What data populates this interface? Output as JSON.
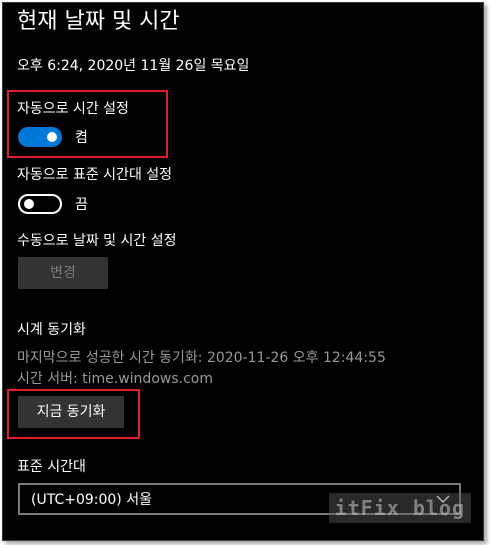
{
  "page": {
    "title": "현재 날짜 및 시간",
    "current_datetime": "오후 6:24, 2020년 11월 26일 목요일"
  },
  "auto_time": {
    "label": "자동으로 시간 설정",
    "state": "on",
    "state_text": "켬"
  },
  "auto_timezone": {
    "label": "자동으로 표준 시간대 설정",
    "state": "off",
    "state_text": "끔"
  },
  "manual": {
    "label": "수동으로 날짜 및 시간 설정",
    "button_label": "변경"
  },
  "sync": {
    "heading": "시계 동기화",
    "last_sync": "마지막으로 성공한 시간 동기화: 2020-11-26 오후 12:44:55",
    "server": "시간 서버: time.windows.com",
    "button_label": "지금 동기화"
  },
  "timezone": {
    "label": "표준 시간대",
    "selected": "(UTC+09:00) 서울"
  },
  "watermark": "itFix blog",
  "colors": {
    "background": "#000000",
    "accent": "#0078d7",
    "highlight": "#e41e26",
    "muted_text": "#999999"
  }
}
